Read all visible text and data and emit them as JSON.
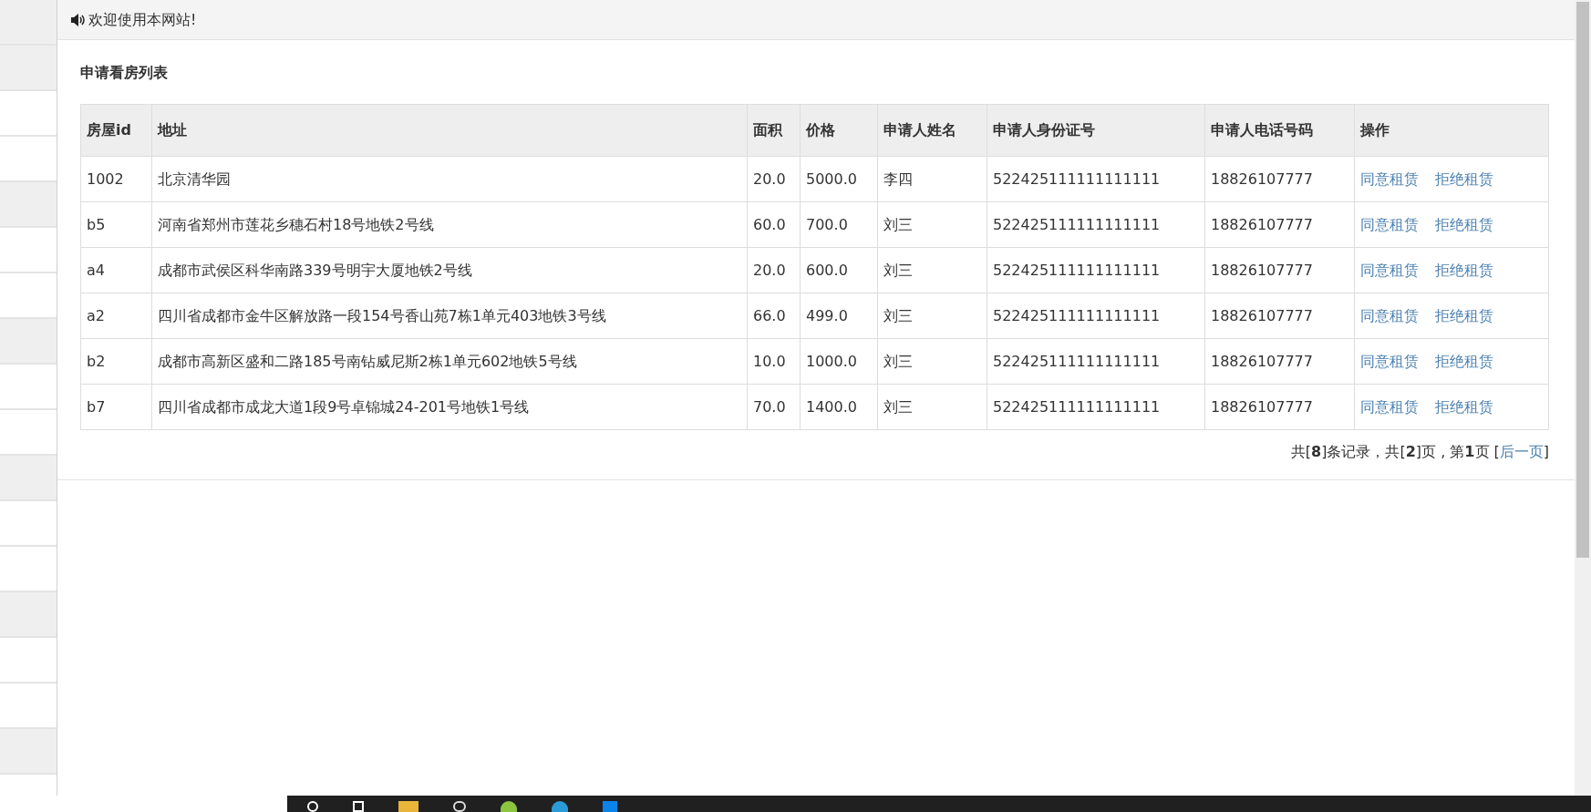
{
  "sidebar": {
    "items": [
      {
        "kind": "header"
      },
      {
        "kind": "header"
      },
      {
        "kind": "item"
      },
      {
        "kind": "item"
      },
      {
        "kind": "header"
      },
      {
        "kind": "item"
      },
      {
        "kind": "item"
      },
      {
        "kind": "header"
      },
      {
        "kind": "item"
      },
      {
        "kind": "item"
      },
      {
        "kind": "header"
      },
      {
        "kind": "item"
      },
      {
        "kind": "item"
      },
      {
        "kind": "header"
      },
      {
        "kind": "item"
      },
      {
        "kind": "item"
      },
      {
        "kind": "header"
      }
    ]
  },
  "notice": "欢迎使用本网站!",
  "title": "申请看房列表",
  "table": {
    "columns": [
      "房屋id",
      "地址",
      "面积",
      "价格",
      "申请人姓名",
      "申请人身份证号",
      "申请人电话号码",
      "操作"
    ],
    "rows": [
      {
        "cells": [
          "1002",
          "北京清华园",
          "20.0",
          "5000.0",
          "李四",
          "522425111111111111",
          "18826107777"
        ],
        "actions": [
          "同意租赁",
          "拒绝租赁"
        ]
      },
      {
        "cells": [
          "b5",
          "河南省郑州市莲花乡穗石村18号地铁2号线",
          "60.0",
          "700.0",
          "刘三",
          "522425111111111111",
          "18826107777"
        ],
        "actions": [
          "同意租赁",
          "拒绝租赁"
        ]
      },
      {
        "cells": [
          "a4",
          "成都市武侯区科华南路339号明宇大厦地铁2号线",
          "20.0",
          "600.0",
          "刘三",
          "522425111111111111",
          "18826107777"
        ],
        "actions": [
          "同意租赁",
          "拒绝租赁"
        ]
      },
      {
        "cells": [
          "a2",
          "四川省成都市金牛区解放路一段154号香山苑7栋1单元403地铁3号线",
          "66.0",
          "499.0",
          "刘三",
          "522425111111111111",
          "18826107777"
        ],
        "actions": [
          "同意租赁",
          "拒绝租赁"
        ]
      },
      {
        "cells": [
          "b2",
          "成都市高新区盛和二路185号南钻威尼斯2栋1单元602地铁5号线",
          "10.0",
          "1000.0",
          "刘三",
          "522425111111111111",
          "18826107777"
        ],
        "actions": [
          "同意租赁",
          "拒绝租赁"
        ]
      },
      {
        "cells": [
          "b7",
          "四川省成都市成龙大道1段9号卓锦城24-201号地铁1号线",
          "70.0",
          "1400.0",
          "刘三",
          "522425111111111111",
          "18826107777"
        ],
        "actions": [
          "同意租赁",
          "拒绝租赁"
        ]
      }
    ]
  },
  "pagination": {
    "summary": "共[**8**]条记录，共[**2**]页 , 第**1**页",
    "next": "后一页",
    "open": "[",
    "close": "]"
  }
}
